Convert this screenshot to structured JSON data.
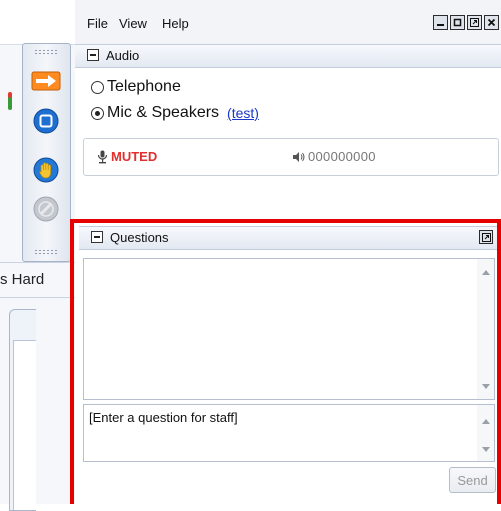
{
  "menu": {
    "items": [
      "File",
      "View",
      "Help"
    ]
  },
  "window_buttons": [
    "minimize",
    "maximize",
    "restore",
    "close"
  ],
  "audio": {
    "title": "Audio",
    "options": [
      {
        "label": "Telephone",
        "selected": false
      },
      {
        "label": "Mic & Speakers",
        "selected": true
      }
    ],
    "test_link": "(test)",
    "mute_status": "MUTED",
    "level_readout": "000000000"
  },
  "questions": {
    "title": "Questions",
    "input_placeholder": "[Enter a question for staff]",
    "send_label": "Send"
  },
  "background": {
    "partial_text": "s Hard"
  },
  "toolbar": {
    "buttons": [
      "arrow-right-icon",
      "stop-square-icon",
      "raise-hand-icon",
      "disabled-pen-icon"
    ]
  },
  "colors": {
    "highlight_frame": "#e60000",
    "muted_text": "#e03030",
    "link": "#1a37c7"
  }
}
